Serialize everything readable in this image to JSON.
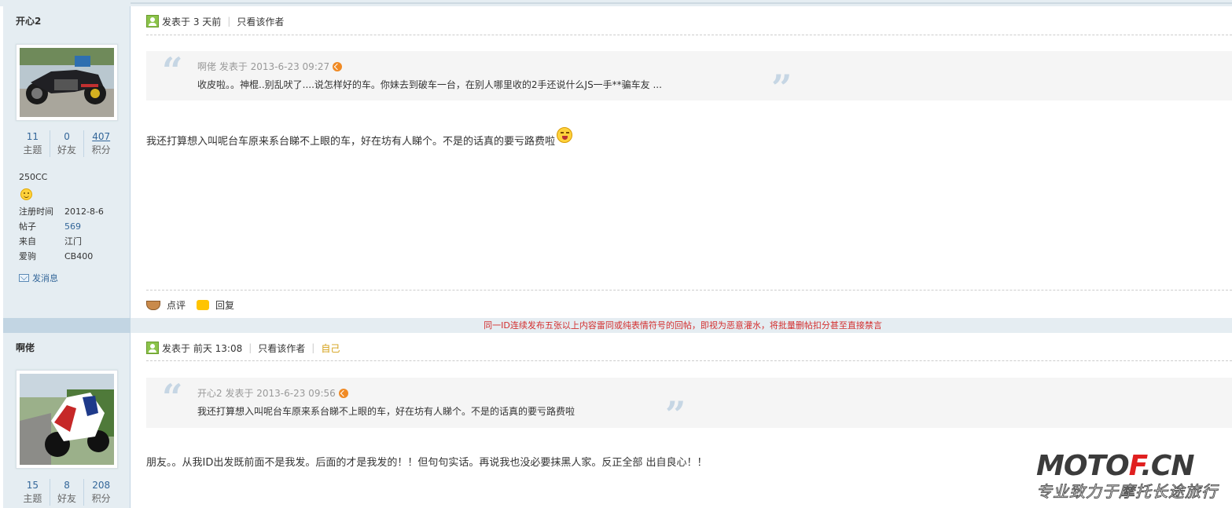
{
  "posts": [
    {
      "author": {
        "name": "开心2",
        "stats": [
          {
            "value": "11",
            "label": "主题"
          },
          {
            "value": "0",
            "label": "好友"
          },
          {
            "value": "407",
            "label": "积分"
          }
        ],
        "group": "250CC",
        "info": [
          {
            "key": "注册时间",
            "value": "2012-8-6"
          },
          {
            "key": "帖子",
            "value": "569"
          },
          {
            "key": "来自",
            "value": "江门"
          },
          {
            "key": "爱驹",
            "value": "CB400"
          }
        ],
        "send_message": "发消息"
      },
      "meta": {
        "posted": "发表于 3 天前",
        "only_author": "只看该作者"
      },
      "quote": {
        "header": "啊佬 发表于 2013-6-23 09:27",
        "body": "收皮啦。。神棍..别乱吠了....说怎样好的车。你妹去到破车一台，在别人哪里收的2手还说什么JS一手**骗车友 ..."
      },
      "text": "我还打算想入叫呢台车原来系台睇不上眼的车，好在坊有人睇个。不是的话真的要亏路费啦",
      "actions": {
        "comment": "点评",
        "reply": "回复"
      }
    },
    {
      "author": {
        "name": "啊佬",
        "stats": [
          {
            "value": "15",
            "label": "主题"
          },
          {
            "value": "8",
            "label": "好友"
          },
          {
            "value": "208",
            "label": "积分"
          }
        ]
      },
      "meta": {
        "posted": "发表于 前天 13:08",
        "only_author": "只看该作者",
        "self": "自己"
      },
      "quote": {
        "header": "开心2 发表于 2013-6-23 09:56",
        "body": "我还打算想入叫呢台车原来系台睇不上眼的车，好在坊有人睇个。不是的话真的要亏路费啦"
      },
      "text": "朋友。。从我ID出发既前面不是我发。后面的才是我发的！！但句句实话。再说我也没必要抹黑人家。反正全部 出自良心！！"
    }
  ],
  "notice": "同一ID连续发布五张以上内容雷同或纯表情符号的回帖，即视为恶意灌水，将批量删帖扣分甚至直接禁言",
  "watermark": {
    "main_a": "MOTO",
    "main_b": "F",
    "main_c": ".CN",
    "sub": "专业致力于摩托长途旅行"
  }
}
